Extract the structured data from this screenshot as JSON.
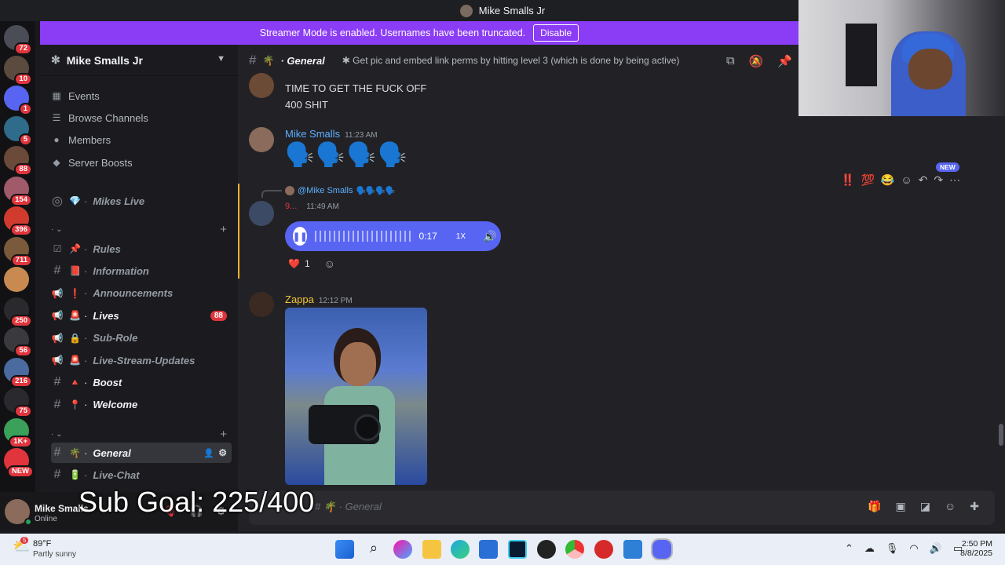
{
  "title_bar": {
    "title": "Mike Smalls Jr"
  },
  "banner": {
    "text": "Streamer Mode is enabled. Usernames have been truncated.",
    "button": "Disable"
  },
  "rail": [
    {
      "badge": "72"
    },
    {
      "badge": "10"
    },
    {
      "badge": "1"
    },
    {
      "badge": "5"
    },
    {
      "badge": "88"
    },
    {
      "badge": "154"
    },
    {
      "badge": "396"
    },
    {
      "badge": "711"
    },
    {
      "badge": ""
    },
    {
      "badge": "250"
    },
    {
      "badge": "56"
    },
    {
      "badge": "216"
    },
    {
      "badge": "75"
    },
    {
      "badge": "1K+"
    },
    {
      "badge": "NEW"
    }
  ],
  "server": {
    "name": "Mike Smalls Jr"
  },
  "nav": [
    {
      "icon": "calendar-icon",
      "label": "Events"
    },
    {
      "icon": "browse-icon",
      "label": "Browse Channels"
    },
    {
      "icon": "members-icon",
      "label": "Members"
    },
    {
      "icon": "boost-icon",
      "label": "Server Boosts"
    }
  ],
  "channels": {
    "stage": {
      "emoji": "💎",
      "label": "Mikes Live"
    },
    "group1": [
      {
        "icon": "check",
        "emoji": "📌",
        "label": "Rules",
        "unread": false,
        "count": ""
      },
      {
        "icon": "hash",
        "emoji": "📕",
        "label": "Information",
        "unread": false,
        "count": ""
      },
      {
        "icon": "megaphone",
        "emoji": "❗",
        "label": "Announcements",
        "unread": false,
        "count": ""
      },
      {
        "icon": "megaphone",
        "emoji": "🚨",
        "label": "Lives",
        "unread": true,
        "count": "88"
      },
      {
        "icon": "megaphone",
        "emoji": "🔒",
        "label": "Sub-Role",
        "unread": false,
        "count": ""
      },
      {
        "icon": "megaphone",
        "emoji": "🚨",
        "label": "Live-Stream-Updates",
        "unread": false,
        "count": ""
      },
      {
        "icon": "hash",
        "emoji": "🔺",
        "label": "Boost",
        "unread": true,
        "count": ""
      },
      {
        "icon": "hash",
        "emoji": "📍",
        "label": "Welcome",
        "unread": true,
        "count": ""
      }
    ],
    "group2": [
      {
        "icon": "hash",
        "emoji": "🌴",
        "label": "General",
        "active": true
      },
      {
        "icon": "hash",
        "emoji": "🔋",
        "label": "Live-Chat",
        "active": false
      }
    ]
  },
  "user": {
    "name": "Mike Smalls",
    "status": "Online"
  },
  "overlay": {
    "sub_goal": "Sub Goal: 225/400"
  },
  "chat": {
    "channel_emoji": "🌴",
    "channel": "General",
    "topic": "✱ Get pic and embed link perms by hitting level 3 (which is done by being active)",
    "messages": {
      "m0_line1": "TIME TO GET THE FUCK OFF",
      "m0_line2": "400 SHIT",
      "m1_author": "Mike Smalls",
      "m1_time": "11:23 AM",
      "m1_emojis": "🗣️🗣️🗣️🗣️",
      "m2_reply_to": "@Mike Smalls",
      "m2_reply_emojis": "🗣️🗣️🗣️🗣️",
      "m2_author": "9...",
      "m2_time": "11:49 AM",
      "m2_voice_time": "0:17",
      "m2_voice_speed": "1X",
      "m2_reaction_emoji": "❤️",
      "m2_reaction_count": "1",
      "m3_author": "Zappa",
      "m3_time": "12:12 PM"
    },
    "hover_actions": {
      "new_badge": "NEW",
      "reactions": [
        "‼️",
        "💯",
        "😂"
      ]
    },
    "input_placeholder": "# 🌴 · General"
  },
  "taskbar": {
    "weather_temp": "89°F",
    "weather_desc": "Partly sunny",
    "weather_badge": "5",
    "time": "2:50 PM",
    "date": "8/8/2025"
  },
  "colors": {
    "accent": "#5865f2",
    "banner": "#8b3cf5",
    "badge": "#e0353d",
    "user_link": "#5cb0ff",
    "zappa": "#f0c43c"
  }
}
